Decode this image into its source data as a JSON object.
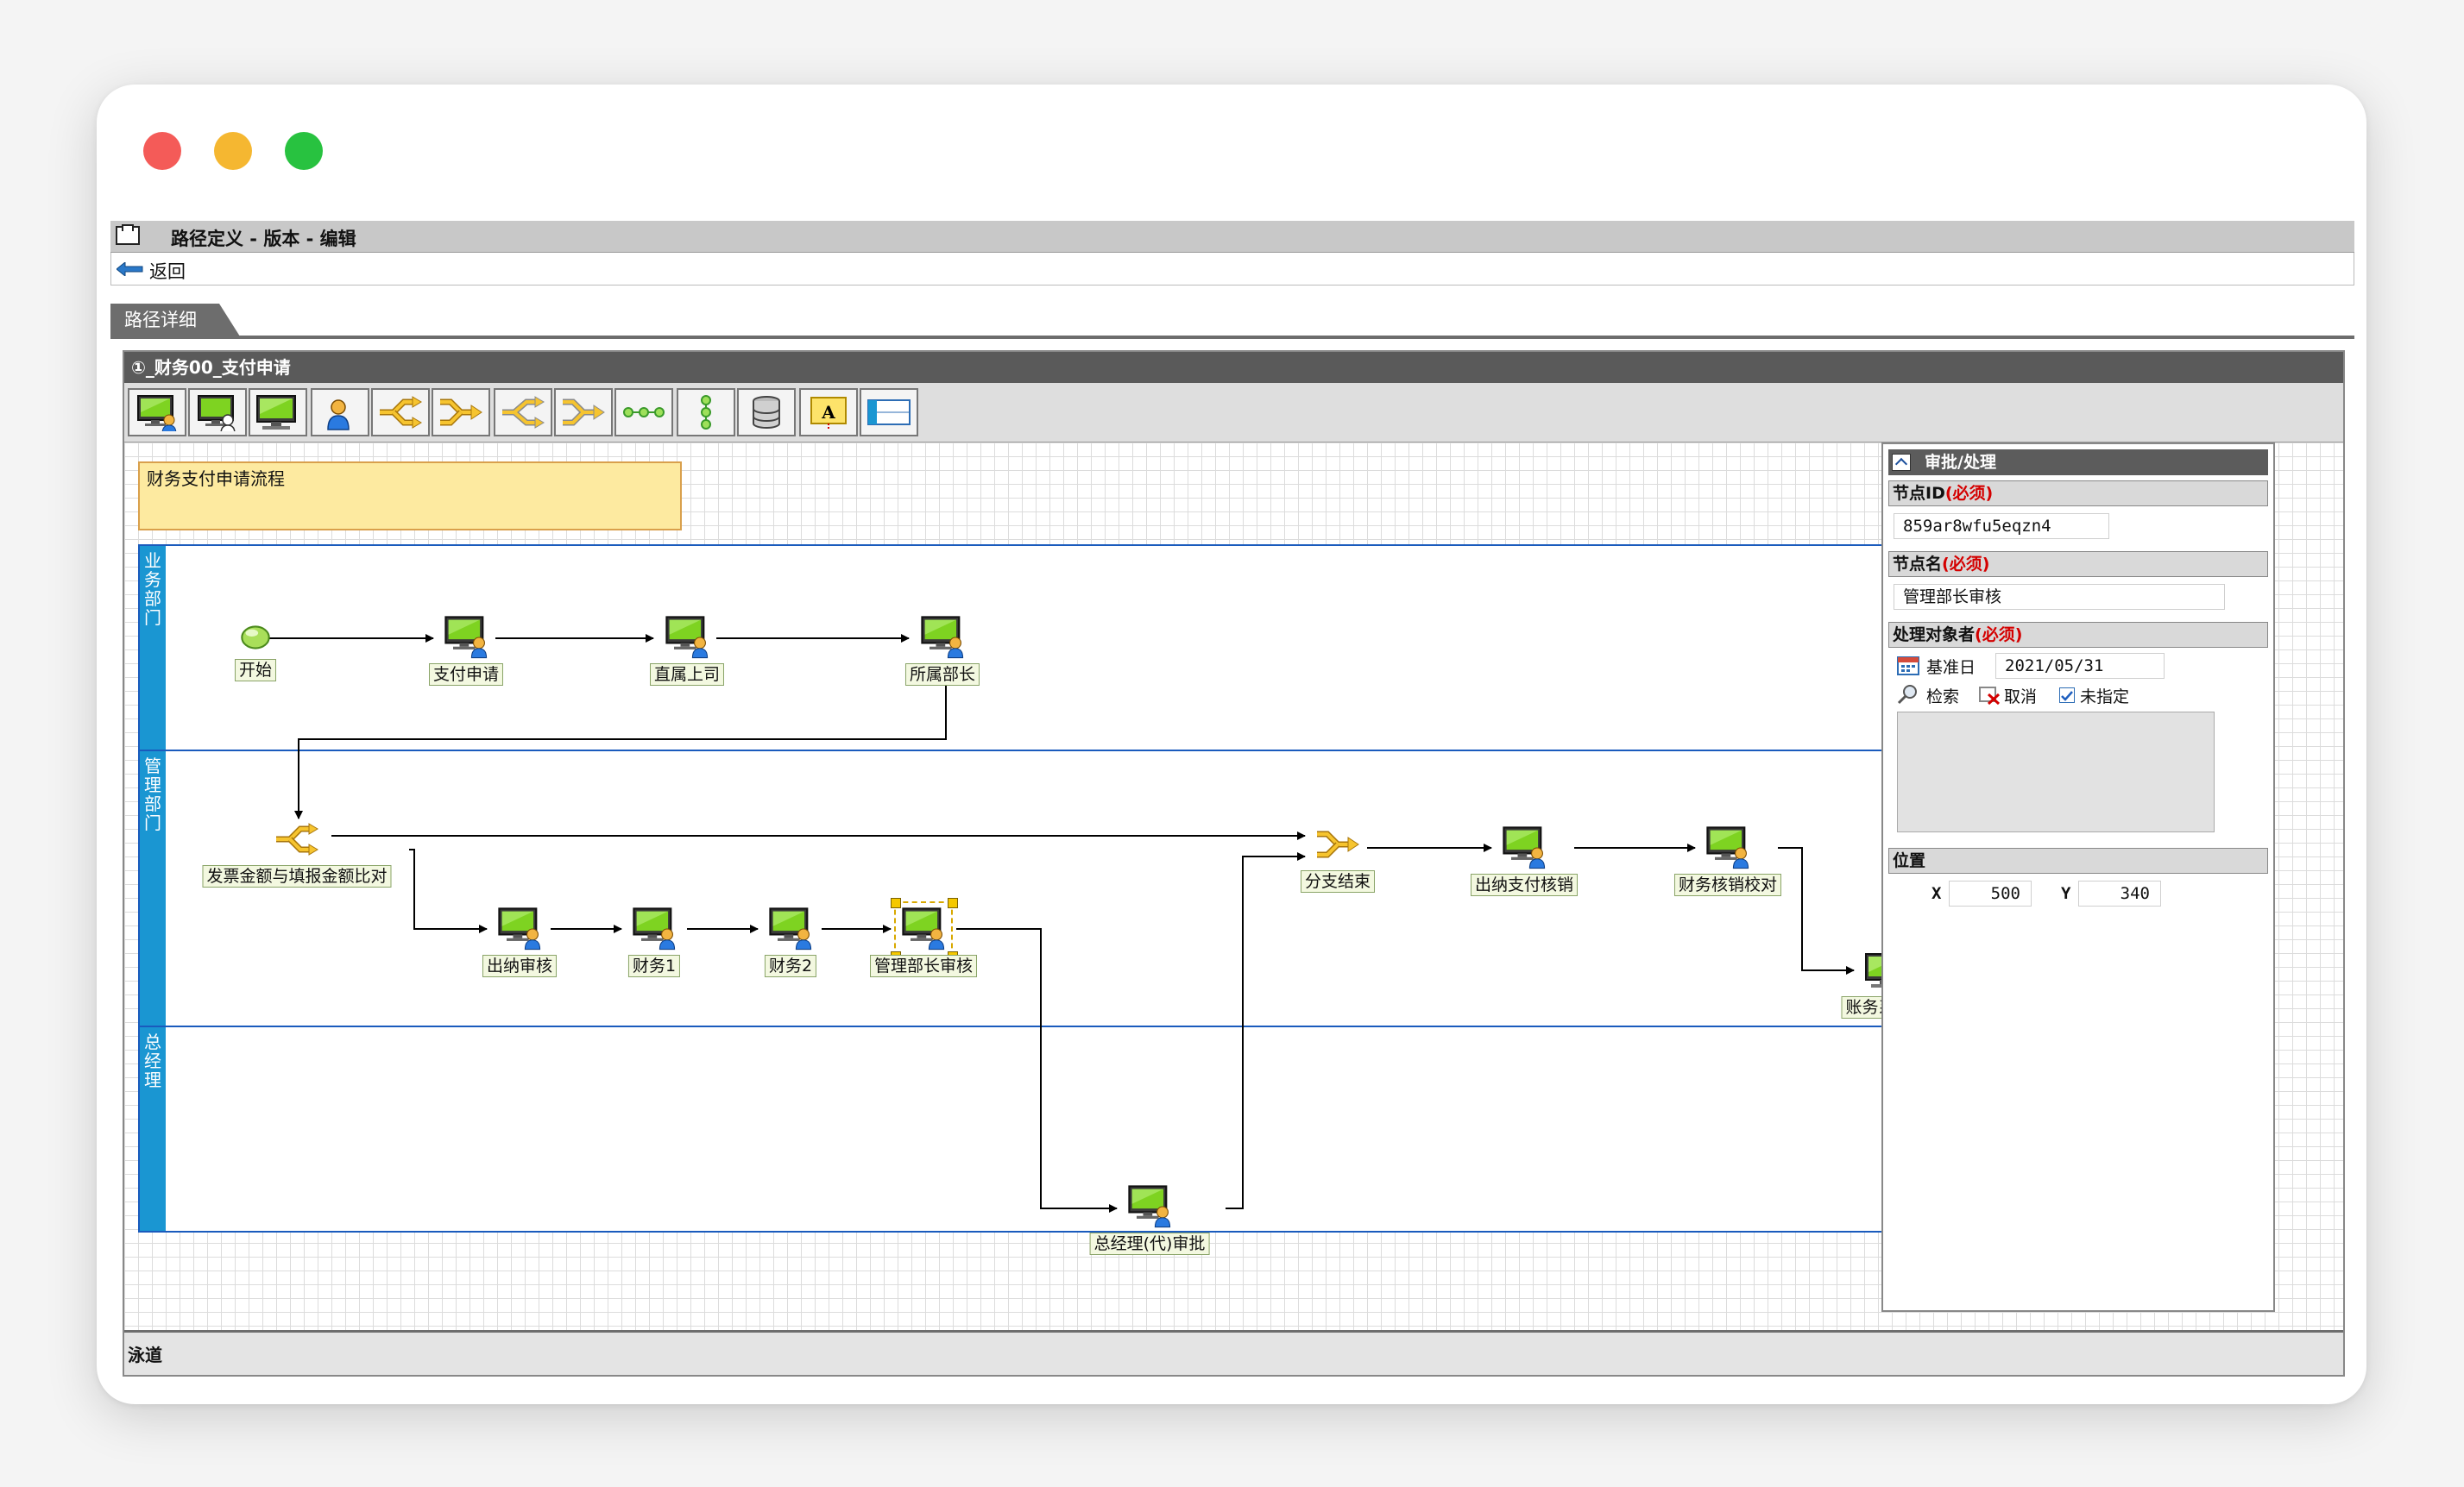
{
  "window": {
    "title": "路径定义 - 版本 - 编辑",
    "back_label": "返回",
    "tab_label": "路径详细"
  },
  "process": {
    "title": "①_财务00_支付申请",
    "note": "财务支付申请流程",
    "toolbar": [
      {
        "name": "approval-node-tool",
        "icon": "computer-user-icon"
      },
      {
        "name": "circulation-node-tool",
        "icon": "computer-user-outline-icon"
      },
      {
        "name": "system-node-tool",
        "icon": "computer-icon"
      },
      {
        "name": "user-node-tool",
        "icon": "user-icon"
      },
      {
        "name": "branch-start-tool",
        "icon": "branch-split-icon"
      },
      {
        "name": "branch-end-tool",
        "icon": "branch-merge-icon"
      },
      {
        "name": "parallel-start-tool",
        "icon": "parallel-split-icon"
      },
      {
        "name": "parallel-end-tool",
        "icon": "parallel-merge-icon"
      },
      {
        "name": "horizontal-layout-tool",
        "icon": "horizontal-chain-icon"
      },
      {
        "name": "vertical-layout-tool",
        "icon": "vertical-chain-icon"
      },
      {
        "name": "database-tool",
        "icon": "database-icon"
      },
      {
        "name": "label-tool",
        "icon": "text-label-icon",
        "text": "A"
      },
      {
        "name": "lane-tool",
        "icon": "swimlane-icon"
      }
    ],
    "lanes": [
      {
        "label": "业务部门"
      },
      {
        "label": "管理部门"
      },
      {
        "label": "总经理"
      }
    ],
    "nodes": [
      {
        "id": "n-start",
        "label": "开始",
        "type": "start",
        "icon": "start-icon"
      },
      {
        "id": "n-apply",
        "label": "支付申请",
        "type": "task",
        "icon": "computer-user-icon"
      },
      {
        "id": "n-boss",
        "label": "直属上司",
        "type": "task",
        "icon": "computer-user-icon"
      },
      {
        "id": "n-deptmgr",
        "label": "所属部长",
        "type": "task",
        "icon": "computer-user-icon"
      },
      {
        "id": "n-compare",
        "label": "发票金额与填报金额比对",
        "type": "branch",
        "icon": "branch-split-icon"
      },
      {
        "id": "n-merge",
        "label": "分支结束",
        "type": "merge",
        "icon": "branch-merge-icon"
      },
      {
        "id": "n-pay",
        "label": "出纳支付核销",
        "type": "task",
        "icon": "computer-user-icon"
      },
      {
        "id": "n-verify",
        "label": "财务核销校对",
        "type": "task",
        "icon": "computer-user-icon"
      },
      {
        "id": "n-cashier",
        "label": "出纳审核",
        "type": "task",
        "icon": "computer-user-icon"
      },
      {
        "id": "n-fin1",
        "label": "财务1",
        "type": "task",
        "icon": "computer-user-icon"
      },
      {
        "id": "n-fin2",
        "label": "财务2",
        "type": "task",
        "icon": "computer-user-icon"
      },
      {
        "id": "n-mgr",
        "label": "管理部长审核",
        "type": "task",
        "icon": "computer-user-icon",
        "selected": true
      },
      {
        "id": "n-acct",
        "label": "账务系统对",
        "type": "system",
        "icon": "computer-icon"
      },
      {
        "id": "n-gm",
        "label": "总经理(代)审批",
        "type": "task",
        "icon": "computer-user-icon"
      }
    ]
  },
  "properties": {
    "header": "审批/处理",
    "node_id_label": "节点ID",
    "required_mark": "(必须)",
    "node_id": "859ar8wfu5eqzn4",
    "node_name_label": "节点名",
    "node_name": "管理部长审核",
    "handler_label": "处理对象者",
    "base_date_label": "基准日",
    "base_date": "2021/05/31",
    "search_label": "检索",
    "cancel_label": "取消",
    "unassigned_label": "未指定",
    "unassigned_checked": true,
    "position_label": "位置",
    "x_label": "X",
    "x_value": "500",
    "y_label": "Y",
    "y_value": "340"
  },
  "status": {
    "lane_label": "泳道"
  },
  "colors": {
    "lane_bar": "#1a96d2",
    "lane_border": "#1a5bbd",
    "note_bg": "#fdeaa0",
    "header_bg": "#5a5a5a",
    "required": "#d40000"
  }
}
